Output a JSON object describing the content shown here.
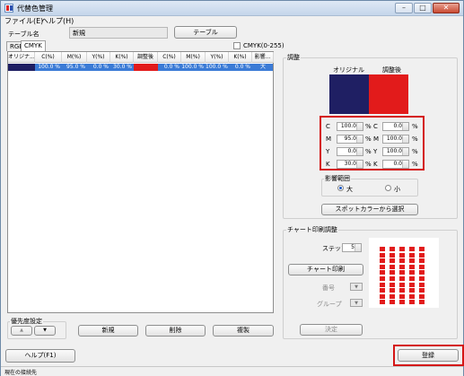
{
  "window": {
    "title": "代替色管理"
  },
  "menu": {
    "file": "ファイル(E)",
    "help": "ヘルプ(H)"
  },
  "table_name": {
    "label": "テーブル名",
    "value": "新規",
    "button": "テーブル"
  },
  "tabs": [
    "RGB",
    "CMYK"
  ],
  "cmyk_range": {
    "label": "CMYK(0-255)",
    "checked": false
  },
  "list": {
    "headers": [
      "オリジナ...",
      "C(%)",
      "M(%)",
      "Y(%)",
      "K(%)",
      "調整後",
      "C(%)",
      "M(%)",
      "Y(%)",
      "K(%)",
      "影響..."
    ],
    "rows": [
      {
        "c1": "100.0 %",
        "m1": "95.0 %",
        "y1": "0.0 %",
        "k1": "30.0 %",
        "c2": "0.0 %",
        "m2": "100.0 %",
        "y2": "100.0 %",
        "k2": "0.0 %",
        "effect": "大",
        "orig_color": "#1f1f63",
        "adj_color": "#e21b1b"
      }
    ]
  },
  "priority": {
    "label": "優先度設定",
    "up": "▲",
    "down": "▼"
  },
  "list_buttons": {
    "new": "新規",
    "delete": "削除",
    "copy": "複製"
  },
  "adjust": {
    "title": "調整",
    "original_label": "オリジナル",
    "adjusted_label": "調整後",
    "original_color": "#1f1f63",
    "adjusted_color": "#e21b1b",
    "rows": [
      {
        "ch": "C",
        "orig": "100.0",
        "pct": "%",
        "ch2": "C",
        "adj": "0.0",
        "pct2": "%"
      },
      {
        "ch": "M",
        "orig": "95.0",
        "pct": "%",
        "ch2": "M",
        "adj": "100.0",
        "pct2": "%"
      },
      {
        "ch": "Y",
        "orig": "0.0",
        "pct": "%",
        "ch2": "Y",
        "adj": "100.0",
        "pct2": "%"
      },
      {
        "ch": "K",
        "orig": "30.0",
        "pct": "%",
        "ch2": "K",
        "adj": "0.0",
        "pct2": "%"
      }
    ],
    "effect_range": {
      "title": "影響範囲",
      "large": "大",
      "small": "小",
      "selected": "大"
    },
    "spot_button": "スポットカラーから選択"
  },
  "chart": {
    "title": "チャート印刷調整",
    "step_label": "ステップ",
    "step_value": "5",
    "print_button": "チャート印刷",
    "number_label": "番号",
    "group_label": "グループ",
    "decide_button": "決定"
  },
  "footer": {
    "help": "ヘルプ(F1)",
    "register": "登録"
  },
  "status": {
    "text": "現在の接続先"
  }
}
